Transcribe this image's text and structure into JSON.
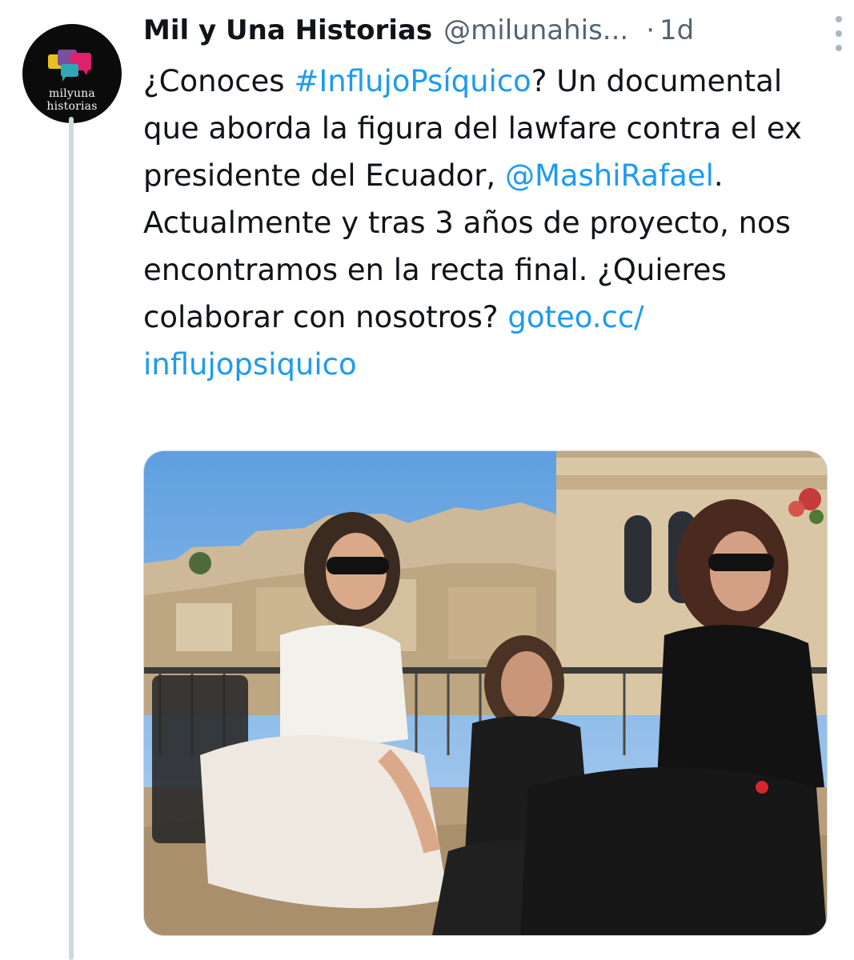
{
  "author": {
    "display_name": "Mil y Una Historias",
    "handle": "@milunahis...",
    "separator": "·",
    "time": "1d",
    "avatar_lines": [
      "milyuna",
      "historias"
    ]
  },
  "tweet": {
    "parts": [
      {
        "text": "¿Conoces ",
        "type": "text"
      },
      {
        "text": "#InflujoPsíquico",
        "type": "hashtag"
      },
      {
        "text": "? Un documental que aborda la figura del lawfare contra el ex presidente del Ecuador, ",
        "type": "text"
      },
      {
        "text": "@MashiRafael",
        "type": "mention"
      },
      {
        "text": ". Actualmente y tras 3 años de proyecto, nos encontramos en la recta final. ¿Quieres colaborar con nosotros?  ",
        "type": "text"
      },
      {
        "text": "goteo.cc/",
        "type": "link"
      },
      {
        "text": "influjopsiquico",
        "type": "link"
      }
    ]
  },
  "media": {
    "kind": "photo"
  },
  "colors": {
    "link": "#1d9bf0",
    "text": "#0f1419",
    "secondary": "#536471",
    "thread_line": "#cfd9de"
  },
  "icons": {
    "more": "more-vertical-icon"
  }
}
